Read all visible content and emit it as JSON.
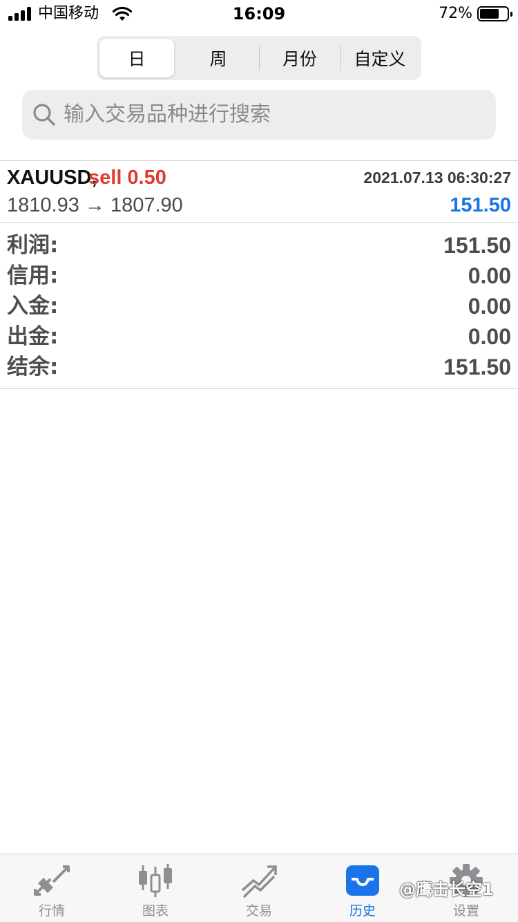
{
  "status_bar": {
    "carrier": "中国移动",
    "time": "16:09",
    "battery_percent": "72%",
    "battery_level": 0.72
  },
  "period_tabs": [
    {
      "label": "日",
      "active": true
    },
    {
      "label": "周",
      "active": false
    },
    {
      "label": "月份",
      "active": false
    },
    {
      "label": "自定义",
      "active": false
    }
  ],
  "search": {
    "placeholder": "输入交易品种进行搜索"
  },
  "trade": {
    "symbol": "XAUUSD,",
    "type_volume": "sell 0.50",
    "datetime": "2021.07.13 06:30:27",
    "prices": "1810.93 → 1807.90",
    "profit": "151.50"
  },
  "summary": [
    {
      "label": "利润:",
      "value": "151.50"
    },
    {
      "label": "信用:",
      "value": "0.00"
    },
    {
      "label": "入金:",
      "value": "0.00"
    },
    {
      "label": "出金:",
      "value": "0.00"
    },
    {
      "label": "结余:",
      "value": "151.50"
    }
  ],
  "tabbar": [
    {
      "label": "行情",
      "icon": "quotes-arrows-icon",
      "active": false
    },
    {
      "label": "图表",
      "icon": "candlestick-chart-icon",
      "active": false
    },
    {
      "label": "交易",
      "icon": "trade-trend-icon",
      "active": false
    },
    {
      "label": "历史",
      "icon": "history-inbox-icon",
      "active": true
    },
    {
      "label": "设置",
      "icon": "gear-icon",
      "active": false
    }
  ],
  "watermark": "@鹰击长空1",
  "colors": {
    "accent": "#1a73e8",
    "sell": "#e23b2e",
    "inactive_tab": "#8e8e93"
  }
}
